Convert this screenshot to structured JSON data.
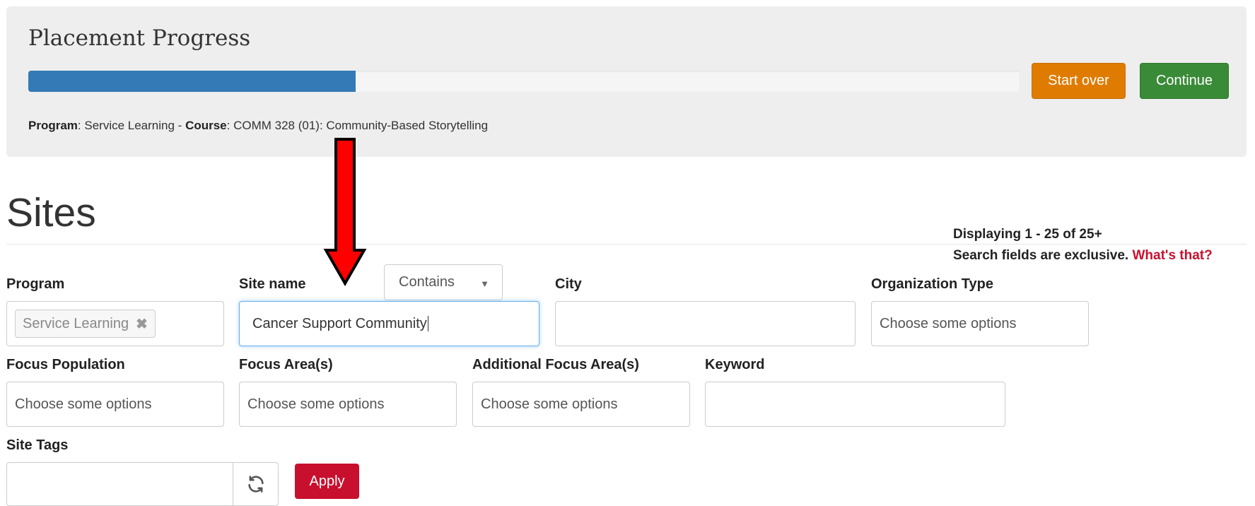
{
  "placement": {
    "title": "Placement Progress",
    "progress_fraction": 0.33,
    "start_over_label": "Start over",
    "continue_label": "Continue",
    "program_label": "Program",
    "program_value": ": Service Learning - ",
    "course_label": "Course",
    "course_value": ": COMM 328 (01): Community-Based Storytelling"
  },
  "sites": {
    "title": "Sites",
    "displaying": "Displaying 1 - 25 of 25+",
    "exclusive_text": "Search fields are exclusive.",
    "whats_that": "What's that?"
  },
  "filters": {
    "program": {
      "label": "Program",
      "chip": "Service Learning"
    },
    "site_name": {
      "label": "Site name",
      "mode": "Contains",
      "value": "Cancer Support Community"
    },
    "city": {
      "label": "City",
      "value": ""
    },
    "org_type": {
      "label": "Organization Type",
      "placeholder": "Choose some options"
    },
    "focus_population": {
      "label": "Focus Population",
      "placeholder": "Choose some options"
    },
    "focus_areas": {
      "label": "Focus Area(s)",
      "placeholder": "Choose some options"
    },
    "additional_focus": {
      "label": "Additional Focus Area(s)",
      "placeholder": "Choose some options"
    },
    "keyword": {
      "label": "Keyword",
      "value": ""
    },
    "site_tags": {
      "label": "Site Tags",
      "value": ""
    },
    "apply_label": "Apply"
  },
  "colors": {
    "progress": "#337ab7",
    "start_over": "#df7c00",
    "continue": "#3a8b38",
    "apply": "#c8102e",
    "arrow": "#ff0000"
  },
  "icons": {
    "arrow": "down-arrow-icon",
    "refresh": "refresh-icon",
    "remove": "close-icon",
    "caret": "caret-down-icon"
  }
}
